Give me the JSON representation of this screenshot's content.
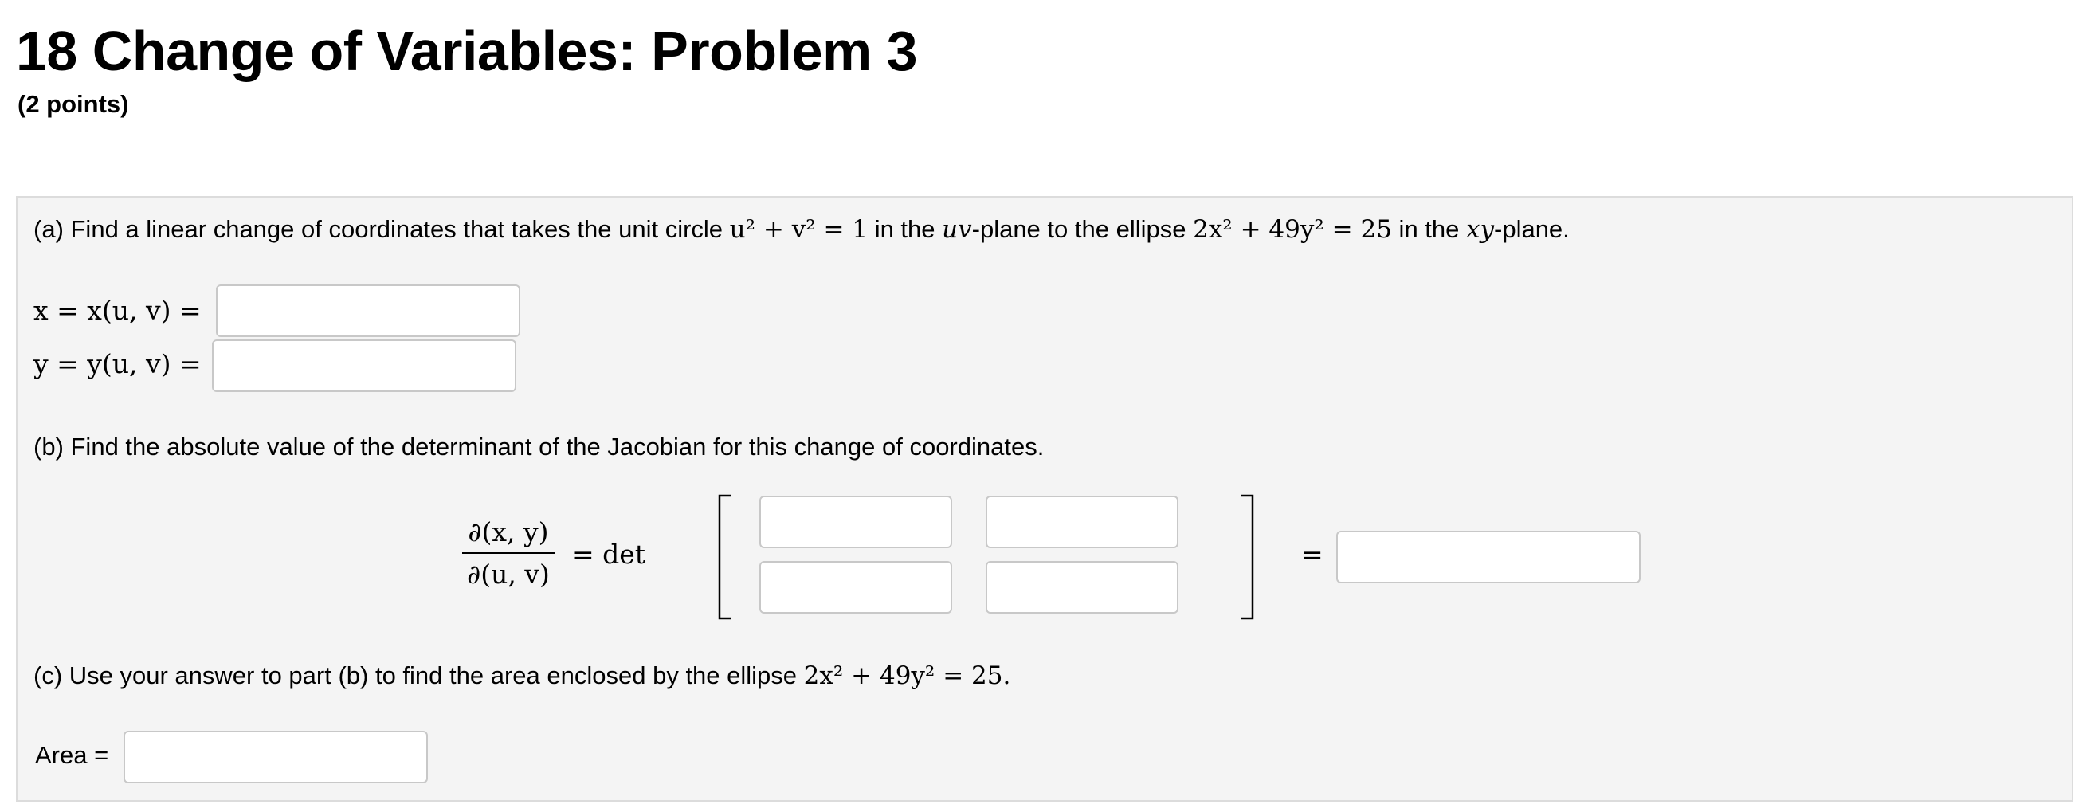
{
  "header": {
    "title": "18 Change of Variables: Problem 3",
    "points": "(2 points)"
  },
  "part_a": {
    "prefix": "(a) Find a linear change of coordinates that takes the unit circle ",
    "circle_eq": "u² + v² = 1",
    "mid1": " in the ",
    "plane_uv": "uv",
    "mid2": "-plane to the ellipse ",
    "ellipse_eq": "2x² + 49y² = 25",
    "mid3": " in the ",
    "plane_xy": "xy",
    "suffix": "-plane.",
    "x_label": "x = x(u, v) =",
    "y_label": "y = y(u, v) =",
    "x_value": "",
    "y_value": ""
  },
  "part_b": {
    "text": "(b) Find the absolute value of the determinant of the Jacobian for this change of coordinates.",
    "frac_num": "∂(x, y)",
    "frac_den": "∂(u, v)",
    "eq_det": "=  det",
    "eq2": "=",
    "m11": "",
    "m12": "",
    "m21": "",
    "m22": "",
    "result": ""
  },
  "part_c": {
    "prefix": "(c) Use your answer to part (b) to find the area enclosed by the ellipse ",
    "ellipse_eq": "2x² + 49y² = 25.",
    "area_label": "Area =",
    "area_value": ""
  }
}
